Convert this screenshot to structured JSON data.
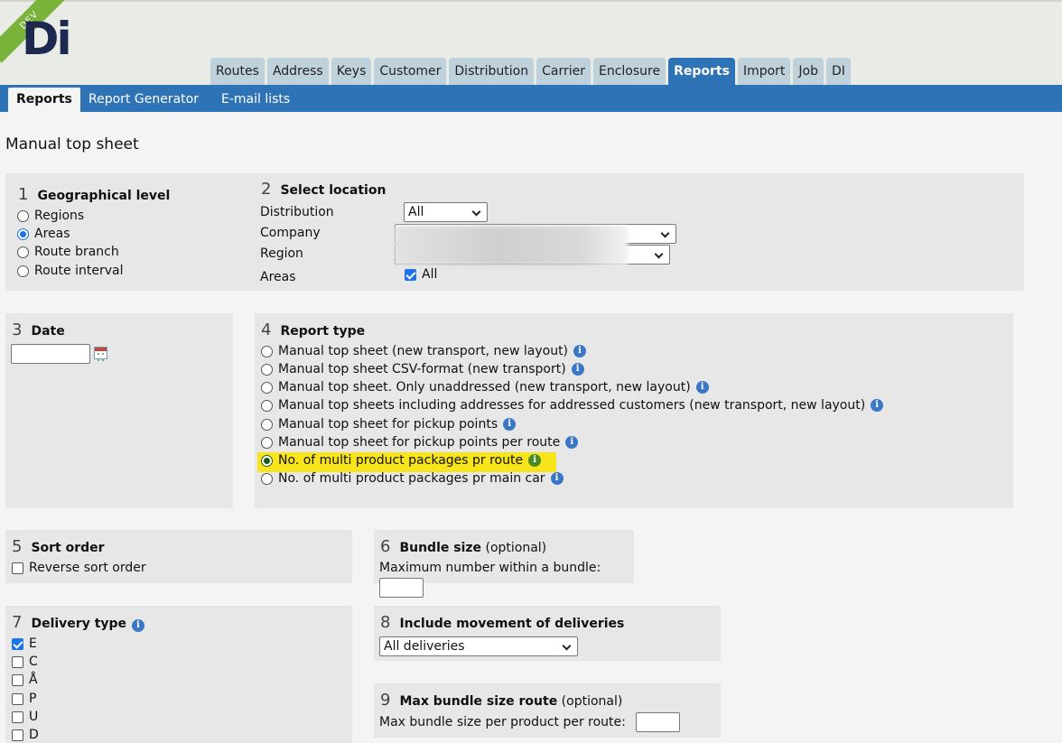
{
  "header": {
    "logo_text": "Di",
    "dev_badge": "DEV",
    "tabs": [
      "Routes",
      "Address",
      "Keys",
      "Customer",
      "Distribution",
      "Carrier",
      "Enclosure",
      "Reports",
      "Import",
      "Job",
      "DI"
    ],
    "active_tab": "Reports"
  },
  "subnav": {
    "tabs": [
      "Reports",
      "Report Generator",
      "E-mail lists"
    ],
    "active_tab": "Reports"
  },
  "page": {
    "title": "Manual top sheet"
  },
  "sections": {
    "geo": {
      "num": "1",
      "title": "Geographical level",
      "options": [
        "Regions",
        "Areas",
        "Route branch",
        "Route interval"
      ],
      "selected": "Areas"
    },
    "location": {
      "num": "2",
      "title": "Select location",
      "distribution_label": "Distribution",
      "distribution_value": "All",
      "company_label": "Company",
      "company_value": "",
      "region_label": "Region",
      "region_value": "",
      "areas_label": "Areas",
      "areas_all_label": "All",
      "areas_all_checked": true
    },
    "date": {
      "num": "3",
      "title": "Date",
      "value": ""
    },
    "report_type": {
      "num": "4",
      "title": "Report type",
      "options": [
        "Manual top sheet (new transport, new layout)",
        "Manual top sheet CSV-format (new transport)",
        "Manual top sheet. Only unaddressed (new transport, new layout)",
        "Manual top sheets including addresses for addressed customers (new transport, new layout)",
        "Manual top sheet for pickup points",
        "Manual top sheet for pickup points per route",
        "No. of multi product packages pr route",
        "No. of multi product packages pr main car"
      ],
      "selected_index": 6
    },
    "sort": {
      "num": "5",
      "title": "Sort order",
      "reverse_label": "Reverse sort order",
      "reverse_checked": false
    },
    "bundle": {
      "num": "6",
      "title": "Bundle size",
      "optional": "(optional)",
      "max_label": "Maximum number within a bundle:",
      "value": ""
    },
    "delivery": {
      "num": "7",
      "title": "Delivery type",
      "types": [
        "E",
        "C",
        "Å",
        "P",
        "U",
        "D"
      ],
      "checked": [
        "E"
      ]
    },
    "movement": {
      "num": "8",
      "title": "Include movement of deliveries",
      "value": "All deliveries"
    },
    "max_bundle": {
      "num": "9",
      "title": "Max bundle size route",
      "optional": "(optional)",
      "label": "Max bundle size per product per route:",
      "value": ""
    }
  },
  "icons": {
    "info": "info-icon",
    "calendar": "calendar-icon",
    "dropdown": "chevron-down-icon"
  },
  "colors": {
    "nav_blue": "#2f73b7",
    "tab_inactive": "#bfd2dc",
    "highlight": "#f7e41b",
    "dev_green": "#7ab33a"
  }
}
